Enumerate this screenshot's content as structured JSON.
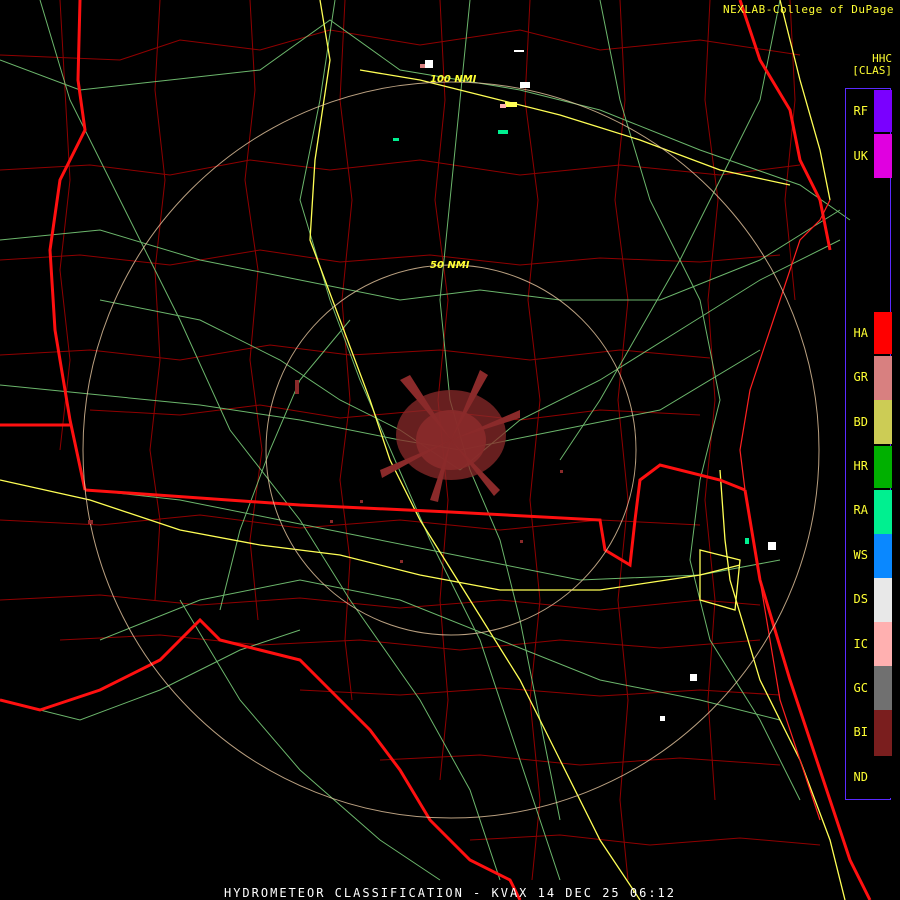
{
  "header": {
    "credit": "NEXLAB-College of DuPage",
    "product_code": "HHC",
    "product_sub": "[CLAS]"
  },
  "footer": {
    "title": "HYDROMETEOR CLASSIFICATION - KVAX 14 DEC 25 06:12"
  },
  "rings": [
    {
      "label": "50 NMI"
    },
    {
      "label": "100 NMI"
    }
  ],
  "legend": {
    "items": [
      {
        "code": "RF",
        "color": "#7a00ff"
      },
      {
        "code": "UK",
        "color": "#e000e0"
      },
      {
        "code": "HA",
        "color": "#ff0000"
      },
      {
        "code": "GR",
        "color": "#d88080"
      },
      {
        "code": "BD",
        "color": "#cccc55"
      },
      {
        "code": "HR",
        "color": "#00b000"
      },
      {
        "code": "RA",
        "color": "#00f090"
      },
      {
        "code": "WS",
        "color": "#0a88ff"
      },
      {
        "code": "DS",
        "color": "#e8e8e8"
      },
      {
        "code": "IC",
        "color": "#ffb0b0"
      },
      {
        "code": "GC",
        "color": "#707070"
      },
      {
        "code": "BI",
        "color": "#7a1e1e"
      },
      {
        "code": "ND",
        "color": "#000000"
      }
    ]
  },
  "colors": {
    "state_borders": "#ff1010",
    "county_borders": "#b00000",
    "highways": "#7fd67f",
    "interstates": "#ffff55",
    "range_rings": "#e8c8a0",
    "echo": "#8a2a2a"
  }
}
